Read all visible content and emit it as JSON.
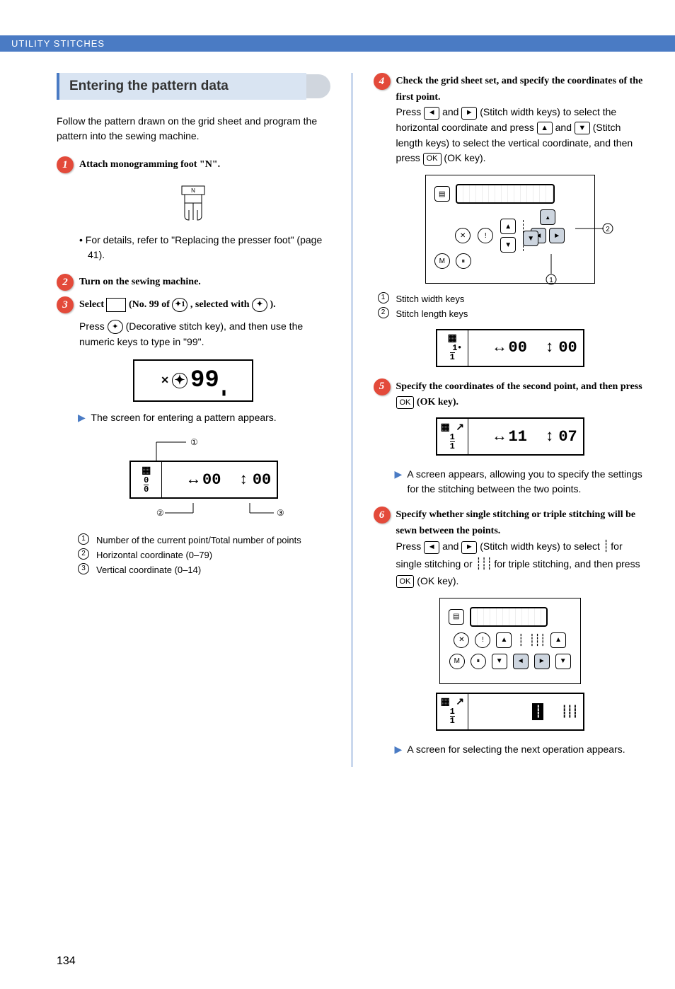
{
  "header": {
    "title": "UTILITY STITCHES"
  },
  "left": {
    "section_title": "Entering the pattern data",
    "intro": "Follow the pattern drawn on the grid sheet and program the pattern into the sewing machine.",
    "step1": {
      "num": "1",
      "text": "Attach monogramming foot \"N\"."
    },
    "step1_detail": "• For details, refer to \"Replacing the presser foot\" (page 41).",
    "step2": {
      "num": "2",
      "text": "Turn on the sewing machine."
    },
    "step3": {
      "num": "3",
      "text_a": "Select ",
      "text_b": " (No. 99 of ",
      "text_c": " , selected with ",
      "text_d": " )."
    },
    "step3_detail": "Press        (Decorative stitch key), and then use the numeric keys to type in \"99\".",
    "screen99": "99",
    "result3": "The screen for entering a pattern appears.",
    "lcd0": {
      "point": "0",
      "total": "0",
      "h": "00",
      "v": "00"
    },
    "lcd0_arrows": {
      "h": "↔",
      "v": "↕"
    },
    "callouts_lcd0": [
      {
        "n": "1",
        "t": "Number of the current point/Total number of points"
      },
      {
        "n": "2",
        "t": "Horizontal coordinate (0–79)"
      },
      {
        "n": "3",
        "t": "Vertical coordinate (0–14)"
      }
    ]
  },
  "right": {
    "step4": {
      "num": "4",
      "bold": "Check the grid sheet set, and specify the coordinates of the first point.",
      "body_a": "Press ",
      "body_b": " and ",
      "body_c": " (Stitch width keys) to select the horizontal coordinate and press ",
      "body_d": " and ",
      "body_e": " (Stitch length keys) to select the vertical coordinate, and then press ",
      "body_f": " (OK key)."
    },
    "panel_callouts": [
      {
        "n": "1",
        "t": "Stitch width keys"
      },
      {
        "n": "2",
        "t": "Stitch length keys"
      }
    ],
    "lcd4": {
      "point": "1",
      "total": "1",
      "h": "00",
      "v": "00"
    },
    "lcd_arrows": {
      "h": "↔",
      "v": "↕"
    },
    "step5": {
      "num": "5",
      "bold_a": "Specify the coordinates of the second point, and then press ",
      "bold_b": " (OK key)."
    },
    "lcd5": {
      "point": "1",
      "total": "1",
      "h": "11",
      "v": "07"
    },
    "result5": "A screen appears, allowing you to specify the settings for the stitching between the two points.",
    "step6": {
      "num": "6",
      "bold": "Specify whether single stitching or triple stitching will be sewn between the points.",
      "body_a": "Press ",
      "body_b": " and ",
      "body_c": " (Stitch width keys) to select ",
      "body_d": " for single stitching or ",
      "body_e": " for triple stitching, and then press ",
      "body_f": " (OK key)."
    },
    "result6": "A screen for selecting the next operation appears."
  },
  "icons": {
    "ok": "OK",
    "left": "◄",
    "right": "►",
    "up": "▲",
    "down": "▼",
    "deco": "✦"
  },
  "page_number": "134"
}
